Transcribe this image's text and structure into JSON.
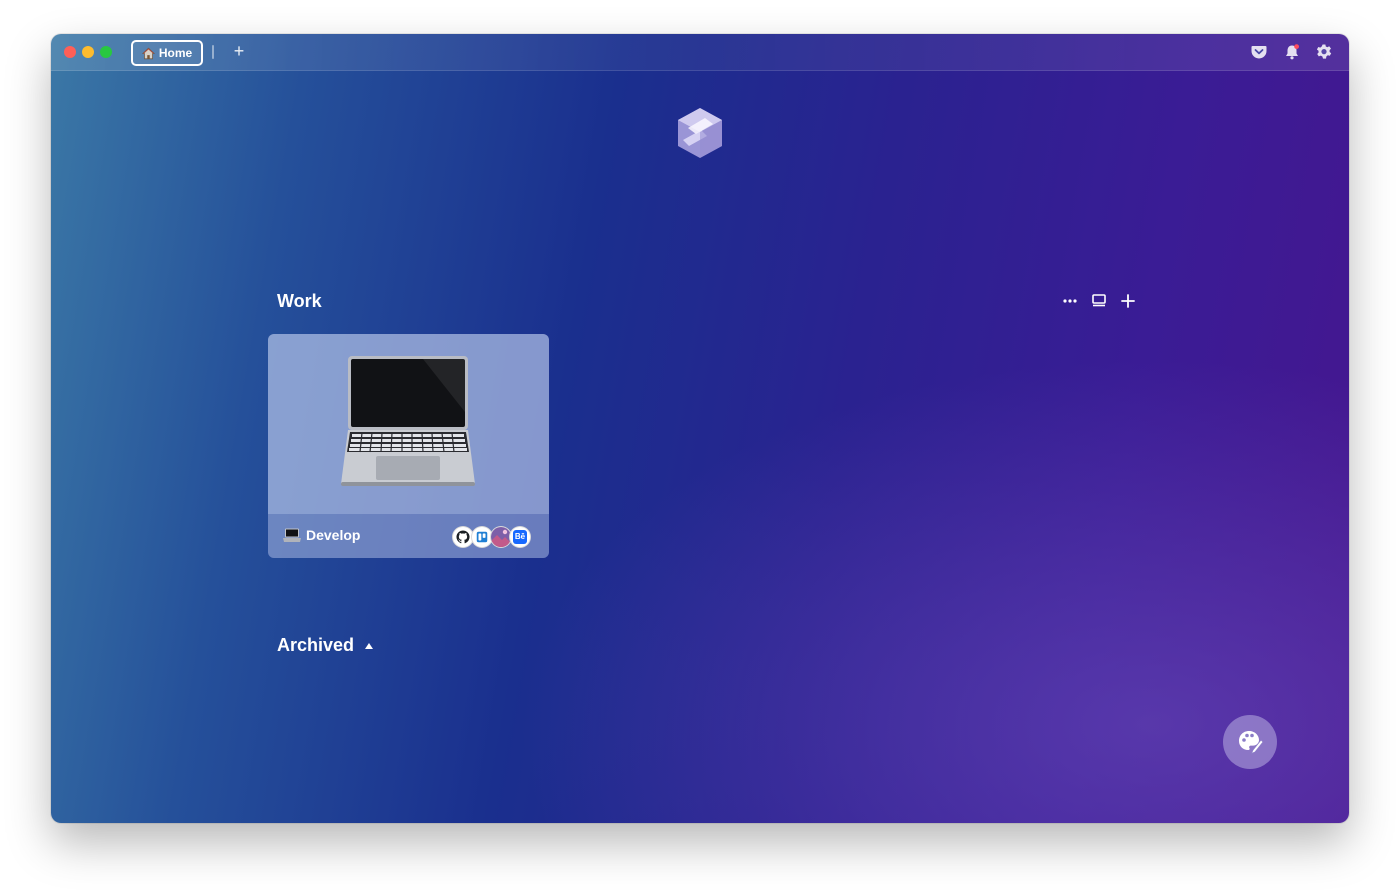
{
  "titlebar": {
    "active_tab": {
      "label": "Home",
      "icon": "house-icon"
    },
    "new_tab_label": "+",
    "right_icons": [
      "pocket-icon",
      "bell-icon",
      "gear-icon"
    ]
  },
  "main": {
    "logo": "app-logo-icon",
    "sections": [
      {
        "title": "Work",
        "actions": [
          "more-icon",
          "display-icon",
          "plus-icon"
        ],
        "cards": [
          {
            "label": "Develop",
            "image": "laptop-icon",
            "links": [
              "github-icon",
              "trello-icon",
              "image-icon",
              "behance-icon"
            ],
            "behance_text": "Bē"
          }
        ]
      }
    ],
    "archived": {
      "title": "Archived",
      "caret": "caret-up-icon"
    }
  },
  "fab": {
    "icon": "palette-icon"
  },
  "colors": {
    "close": "#ff5f57",
    "minimize": "#febc2e",
    "maximize": "#28c840"
  }
}
